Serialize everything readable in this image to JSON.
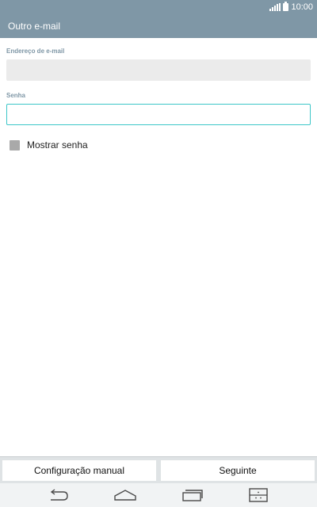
{
  "status_bar": {
    "time": "10:00"
  },
  "header": {
    "title": "Outro e-mail"
  },
  "form": {
    "email_label": "Endereço de e-mail",
    "email_value": "",
    "password_label": "Senha",
    "password_value": "",
    "show_password_label": "Mostrar senha",
    "show_password_checked": false
  },
  "actions": {
    "manual_setup": "Configuração manual",
    "next": "Seguinte"
  },
  "nav": {
    "icons": [
      "back-icon",
      "home-icon",
      "recent-apps-icon",
      "dual-window-icon"
    ]
  },
  "colors": {
    "header": "#7f97a6",
    "focus": "#3cc6c8",
    "input_disabled": "#ebebeb"
  }
}
